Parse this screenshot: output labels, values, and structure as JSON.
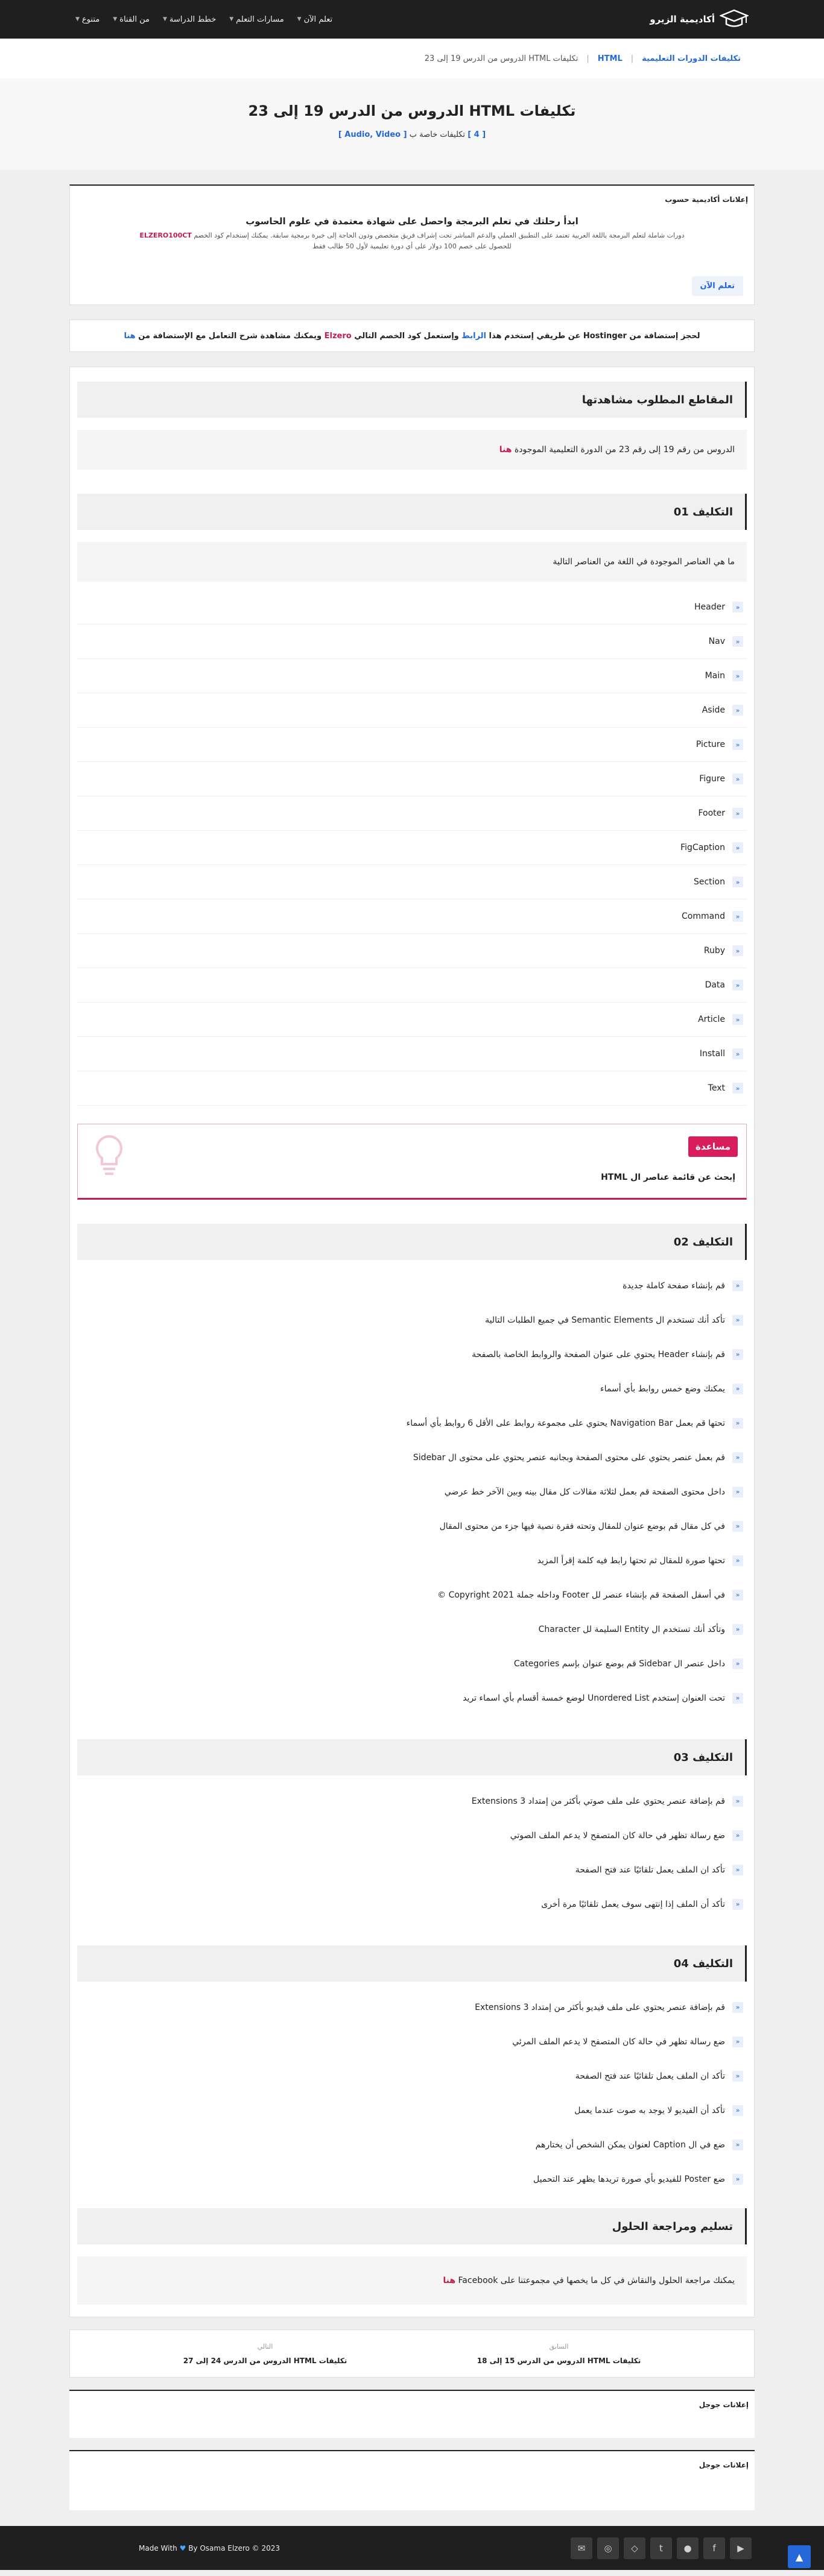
{
  "header": {
    "logo_text": "أكاديمية الزيرو",
    "nav": [
      "تعلم الآن",
      "مسارات التعلم",
      "خطط الدراسة",
      "من القناة",
      "متنوع"
    ]
  },
  "breadcrumb": [
    "تكليفات الدورات التعليمية",
    "HTML",
    "تكليفات HTML الدروس من الدرس 19 إلى 23"
  ],
  "hero": {
    "title": "تكليفات HTML الدروس من الدرس 19 إلى 23",
    "count": "[ 4 ]",
    "label": "تكليفات خاصة ب",
    "tags": "[ Audio, Video ]"
  },
  "ads": {
    "title": "إعلانات أكاديمية حسوب",
    "heading": "ابدأ رحلتك في تعلم البرمجة واحصل على شهادة معتمدة في علوم الحاسوب",
    "text": "دورات شاملة لتعلم البرمجة باللغة العربية تعتمد على التطبيق العملي والدعم المباشر تحت إشراف فريق متخصص ودون الحاجة إلى خبرة برمجية سابقة. يمكنك إستخدام كود الخصم",
    "code": "ELZERO100CT",
    "text2": "للحصول على خصم 100 دولار على أي دورة تعليمية لأول 50 طالب فقط",
    "button": "تعلم الآن"
  },
  "promo": {
    "p1": "لحجز إستضافة من Hostinger عن طريقي إستخدم هذا",
    "link": "الرابط",
    "p2": "وإستعمل كود الخصم التالي",
    "code": "Elzero",
    "p3": "ويمكنك مشاهدة شرح التعامل مع الإستضافة من",
    "here": "هنا"
  },
  "videos": {
    "title": "المقاطع المطلوب مشاهدتها",
    "text": "الدروس من رقم 19 إلى رقم 23 من الدورة التعليمية الموجودة",
    "here": "هنا"
  },
  "a1": {
    "title": "التكليف 01",
    "question": "ما هي العناصر الموجودة في اللغة من العناصر التالية",
    "items": [
      "Header",
      "Nav",
      "Main",
      "Aside",
      "Picture",
      "Figure",
      "Footer",
      "FigCaption",
      "Section",
      "Command",
      "Ruby",
      "Data",
      "Article",
      "Install",
      "Text"
    ]
  },
  "help": {
    "badge": "مساعدة",
    "text": "إبحث عن قائمة عناصر ال HTML"
  },
  "a2": {
    "title": "التكليف 02",
    "items": [
      "قم بإنشاء صفحة كاملة جديدة",
      "تأكد أنك تستخدم ال Semantic Elements في جميع الطلبات التالية",
      "قم بإنشاء Header يحتوي على عنوان الصفحة والروابط الخاصة بالصفحة",
      "يمكنك وضع خمس روابط بأي أسماء",
      "تحتها قم بعمل Navigation Bar يحتوي على مجموعة روابط على الأقل 6 روابط بأي أسماء",
      "قم بعمل عنصر يحتوي على محتوى الصفحة وبجانبه عنصر يحتوي على محتوى ال Sidebar",
      "داخل محتوى الصفحة قم بعمل لثلاثة مقالات كل مقال بينه وبين الآخر خط عرضي",
      "في كل مقال قم بوضع عنوان للمقال وتحته فقرة نصية فيها جزء من محتوى المقال",
      "تحتها صورة للمقال ثم تحتها رابط فيه كلمة إقرأ المزيد",
      "في أسفل الصفحة قم بإنشاء عنصر لل Footer وداخله جملة Copyright 2021 ©",
      "وتأكد أنك تستخدم ال Entity السليمة لل Character",
      "داخل عنصر ال Sidebar قم بوضع عنوان بإسم Categories",
      "تحت العنوان إستخدم Unordered List لوضع خمسة أقسام بأي اسماء تريد"
    ]
  },
  "a3": {
    "title": "التكليف 03",
    "items": [
      "قم بإضافة عنصر يحتوي على ملف صوتي بأكثر من إمتداد Extensions 3",
      "ضع رسالة تظهر في حالة كان المتصفح لا يدعم الملف الصوتي",
      "تأكد ان الملف يعمل تلقائيًا عند فتح الصفحة",
      "تأكد أن الملف إذا إنتهى سوف يعمل تلقائيًا مرة أخرى"
    ]
  },
  "a4": {
    "title": "التكليف 04",
    "items": [
      "قم بإضافة عنصر يحتوي على ملف فيديو بأكثر من إمتداد Extensions 3",
      "ضع رسالة تظهر في حالة كان المتصفح لا يدعم الملف المرئي",
      "تأكد ان الملف يعمل تلقائيًا عند فتح الصفحة",
      "تأكد أن الفيديو لا يوجد به صوت عندما يعمل",
      "ضع في ال Caption لعنوان يمكن الشخص أن يختارهم",
      "ضع Poster للفيديو بأي صورة تريدها يظهر عند التحميل"
    ]
  },
  "review": {
    "title": "تسليم ومراجعة الحلول",
    "text": "يمكنك مراجعة الحلول والنقاش في كل ما يخصها في مجموعتنا على Facebook",
    "here": "هنا"
  },
  "posts": {
    "prev_label": "السابق",
    "prev": "تكليفات HTML الدروس من الدرس 15 إلى 18",
    "next_label": "التالي",
    "next": "تكليفات HTML الدروس من الدرس 24 إلى 27"
  },
  "google_ads": "إعلانات جوجل",
  "footer": {
    "made": "Made With",
    "by": "By Osama Elzero © 2023",
    "social": [
      "youtube-icon",
      "facebook-icon",
      "github-icon",
      "twitter-icon",
      "codepen-icon",
      "instagram-icon",
      "email-icon"
    ]
  }
}
